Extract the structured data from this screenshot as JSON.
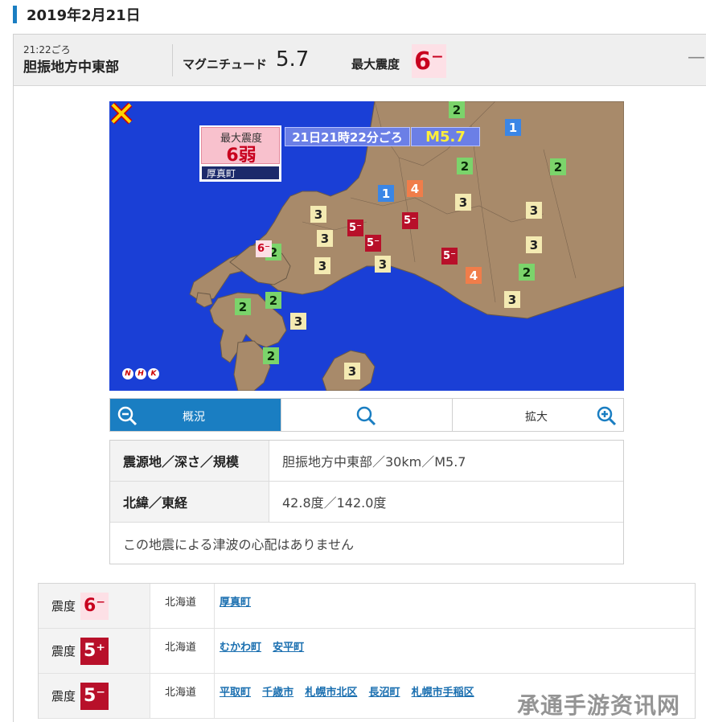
{
  "header": {
    "date": "2019年2月21日"
  },
  "summary": {
    "time": "21:22ごろ",
    "area": "胆振地方中東部",
    "magnitude_label": "マグニチュード",
    "magnitude_value": "5.7",
    "max_intensity_label": "最大震度",
    "max_intensity_value": "6⁻",
    "collapse_symbol": "—"
  },
  "map": {
    "max_intensity_label": "最大震度",
    "max_intensity_value": "6弱",
    "town": "厚真町",
    "time": "21日21時22分ごろ",
    "magnitude": "M5.7",
    "logo": [
      "N",
      "H",
      "K"
    ],
    "markers": [
      {
        "v": "2",
        "cls": "i2"
      },
      {
        "v": "1",
        "cls": "i1"
      },
      {
        "v": "2",
        "cls": "i2"
      },
      {
        "v": "2",
        "cls": "i2"
      },
      {
        "v": "1",
        "cls": "i1"
      },
      {
        "v": "4",
        "cls": "i4"
      },
      {
        "v": "3",
        "cls": "i3"
      },
      {
        "v": "3",
        "cls": "i3"
      },
      {
        "v": "3",
        "cls": "i3"
      },
      {
        "v": "3",
        "cls": "i3"
      },
      {
        "v": "5⁻",
        "cls": "i5m"
      },
      {
        "v": "5⁻",
        "cls": "i5m"
      },
      {
        "v": "3",
        "cls": "i3"
      },
      {
        "v": "5⁻",
        "cls": "i5m"
      },
      {
        "v": "3",
        "cls": "i3"
      },
      {
        "v": "2",
        "cls": "i2"
      },
      {
        "v": "3",
        "cls": "i3"
      },
      {
        "v": "6⁻",
        "cls": "i6m"
      },
      {
        "v": "5⁻",
        "cls": "i5m"
      },
      {
        "v": "4",
        "cls": "i4"
      },
      {
        "v": "2",
        "cls": "i2"
      },
      {
        "v": "2",
        "cls": "i2"
      },
      {
        "v": "2",
        "cls": "i2"
      },
      {
        "v": "3",
        "cls": "i3"
      },
      {
        "v": "3",
        "cls": "i3"
      },
      {
        "v": "2",
        "cls": "i2"
      },
      {
        "v": "3",
        "cls": "i3"
      }
    ]
  },
  "zoom": {
    "overview_label": "概況",
    "zoom_label": "拡大"
  },
  "info": {
    "rows": [
      {
        "head": "震源地／深さ／規模",
        "value": "胆振地方中東部／30km／M5.7"
      },
      {
        "head": "北緯／東経",
        "value": "42.8度／142.0度"
      }
    ],
    "note": "この地震による津波の心配はありません"
  },
  "intensity_rows": [
    {
      "label": "震度",
      "badge": "6⁻",
      "cls": "b6m",
      "pref": "北海道",
      "towns": [
        "厚真町"
      ]
    },
    {
      "label": "震度",
      "badge": "5⁺",
      "cls": "b5p",
      "pref": "北海道",
      "towns": [
        "むかわ町",
        "安平町"
      ]
    },
    {
      "label": "震度",
      "badge": "5⁻",
      "cls": "b5m",
      "pref": "北海道",
      "towns": [
        "平取町",
        "千歳市",
        "札幌市北区",
        "長沼町",
        "札幌市手稲区"
      ]
    }
  ],
  "watermark": "承通手游资讯网",
  "colors": {
    "accent": "#1a7ec2",
    "map_sea": "#1a3fd6",
    "map_land": "#a88a6a",
    "intensity_6_minus": "#c8001e",
    "intensity_5": "#b8102a"
  }
}
